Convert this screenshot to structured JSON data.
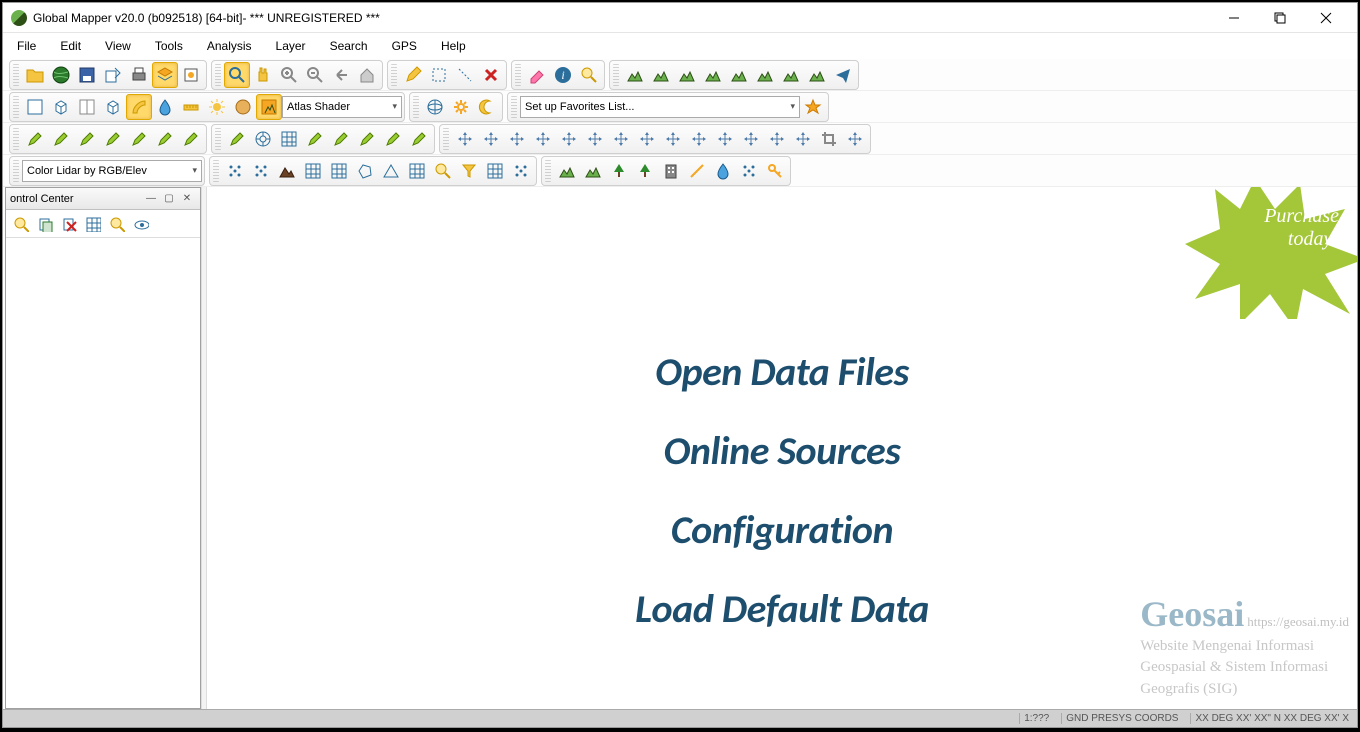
{
  "title": "Global Mapper v20.0 (b092518) [64-bit]- *** UNREGISTERED ***",
  "menu": [
    "File",
    "Edit",
    "View",
    "Tools",
    "Analysis",
    "Layer",
    "Search",
    "GPS",
    "Help"
  ],
  "shader_combo": "Atlas Shader",
  "favorites_combo": "Set up Favorites List...",
  "lidar_combo": "Color Lidar by RGB/Elev",
  "panel": {
    "title": "ontrol Center"
  },
  "canvas_links": {
    "open": "Open Data Files",
    "online": "Online Sources",
    "config": "Configuration",
    "default": "Load Default Data"
  },
  "burst": {
    "line1": "Purchase",
    "line2": "today!"
  },
  "watermark": {
    "brand": "Geosai",
    "url": "https://geosai.my.id",
    "sub1": "Website Mengenai Informasi",
    "sub2": "Geospasial & Sistem Informasi",
    "sub3": "Geografis (SIG)"
  },
  "status": {
    "scale": "1:???",
    "proj": "GND PRESYS COORDS",
    "coords": "XX DEG XX' XX\" N XX DEG XX' X"
  },
  "icons": {
    "open": "folder",
    "globe": "globe",
    "save": "save",
    "export": "export",
    "print": "print",
    "layers": "layers",
    "config": "config",
    "zoom_tool": "zoom",
    "pan_tool": "pan",
    "zoom_in": "zoom-in",
    "zoom_out": "zoom-out",
    "back": "back",
    "home": "home",
    "pencil": "pencil",
    "sel_rect": "select",
    "sel_line": "select-line",
    "delete_x": "delete",
    "eraser": "eraser",
    "info": "info",
    "find": "find",
    "terrain1": "terrain",
    "terrain2": "terrain",
    "terrain3": "terrain",
    "terrain4": "terrain",
    "terrain5": "terrain",
    "terrain6": "terrain",
    "terrain7": "terrain",
    "terrain8": "terrain",
    "plane": "plane",
    "view2d": "2d",
    "view3d": "3d",
    "split": "split",
    "cube": "cube",
    "paint": "paint",
    "drop": "drop",
    "ruler": "ruler",
    "sun": "sun",
    "world": "world-icon",
    "atlas": "atlas",
    "globe_sm": "globe-grid",
    "gear": "gear",
    "moon": "moon",
    "star": "star",
    "d1": "draw",
    "d2": "draw",
    "d3": "draw",
    "d4": "draw",
    "d5": "draw",
    "d6": "draw",
    "d7": "draw",
    "d8": "target",
    "d9": "grid",
    "d10": "draw",
    "d11": "draw",
    "d12": "draw",
    "d13": "draw",
    "d14": "draw",
    "m1": "move",
    "m2": "move",
    "m3": "move",
    "m4": "move",
    "m5": "move",
    "m6": "move",
    "m7": "move",
    "m8": "move",
    "m9": "move",
    "m10": "move",
    "m11": "move",
    "m12": "move",
    "m13": "move",
    "m14": "move",
    "m15": "crop",
    "m16": "move",
    "a1": "dots",
    "a2": "dots",
    "a3": "mtn",
    "a4": "grid",
    "a5": "grid",
    "a6": "poly",
    "a7": "tri",
    "a8": "grid",
    "a9": "find",
    "a10": "filter",
    "a11": "grid",
    "a12": "dots",
    "s1": "terrain",
    "s2": "terrain",
    "s3": "tree",
    "s4": "tree",
    "s5": "building",
    "s6": "line",
    "s7": "drop",
    "s8": "dots",
    "s9": "key",
    "p1": "find",
    "p2": "copy",
    "p3": "del",
    "p4": "grid",
    "p5": "find",
    "p6": "eye"
  }
}
